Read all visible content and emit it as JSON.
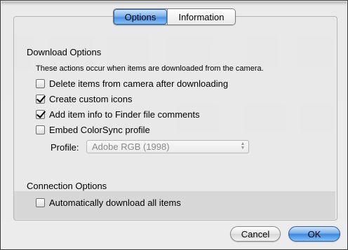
{
  "tabs": [
    {
      "label": "Options",
      "active": true
    },
    {
      "label": "Information",
      "active": false
    }
  ],
  "download_section": {
    "title": "Download Options",
    "note": "These actions occur when items are downloaded from the camera.",
    "options": [
      {
        "label": "Delete items from camera after downloading",
        "checked": false
      },
      {
        "label": "Create custom icons",
        "checked": true
      },
      {
        "label": "Add item info to Finder file comments",
        "checked": true
      },
      {
        "label": "Embed ColorSync profile",
        "checked": false
      }
    ],
    "profile_label": "Profile:",
    "profile_value": "Adobe RGB (1998)",
    "profile_enabled": false
  },
  "connection_section": {
    "title": "Connection Options",
    "auto_download_label": "Automatically download all items",
    "auto_download_checked": false
  },
  "buttons": {
    "cancel": "Cancel",
    "ok": "OK"
  },
  "colors": {
    "accent_blue": "#4c91e3",
    "default_button_border": "#2d5d9e",
    "sheet_border": "#3b3b3b"
  },
  "icons": {
    "checkmark": "checkmark-icon",
    "popup_arrows": "updown-arrows-icon"
  }
}
